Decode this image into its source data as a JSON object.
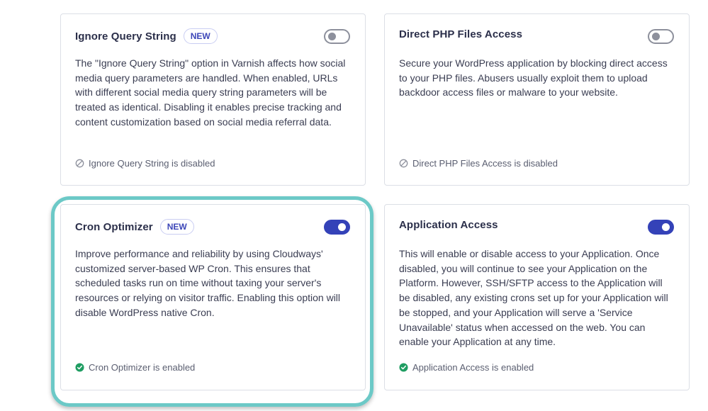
{
  "cards": [
    {
      "title": "Ignore Query String",
      "badge": "NEW",
      "toggle_on": false,
      "description": "The \"Ignore Query String\" option in Varnish affects how social media query parameters are handled. When enabled, URLs with different social media query string parameters will be treated as identical. Disabling it enables precise tracking and content customization based on social media referral data.",
      "status": "Ignore Query String is disabled",
      "status_icon": "disabled-icon"
    },
    {
      "title": "Direct PHP Files Access",
      "badge": "",
      "toggle_on": false,
      "description": "Secure your WordPress application by blocking direct access to your PHP files. Abusers usually exploit them to upload backdoor access files or malware to your website.",
      "status": "Direct PHP Files Access is disabled",
      "status_icon": "disabled-icon"
    },
    {
      "title": "Cron Optimizer",
      "badge": "NEW",
      "toggle_on": true,
      "description": "Improve performance and reliability by using Cloudways' customized server-based WP Cron. This ensures that scheduled tasks run on time without taxing your server's resources or relying on visitor traffic. Enabling this option will disable WordPress native Cron.",
      "status": "Cron Optimizer is enabled",
      "status_icon": "check-circle-icon"
    },
    {
      "title": "Application Access",
      "badge": "",
      "toggle_on": true,
      "description": "This will enable or disable access to your Application. Once disabled, you will continue to see your Application on the Platform. However, SSH/SFTP access to the Application will be disabled, any existing crons set up for your Application will be stopped, and your Application will serve a 'Service Unavailable' status when accessed on the web. You can enable your Application at any time.",
      "status": "Application Access is enabled",
      "status_icon": "check-circle-icon"
    }
  ],
  "colors": {
    "accent": "#3442b8",
    "highlight": "#6cc9c7",
    "enabled": "#1f9d62",
    "disabled": "#8d909c"
  }
}
